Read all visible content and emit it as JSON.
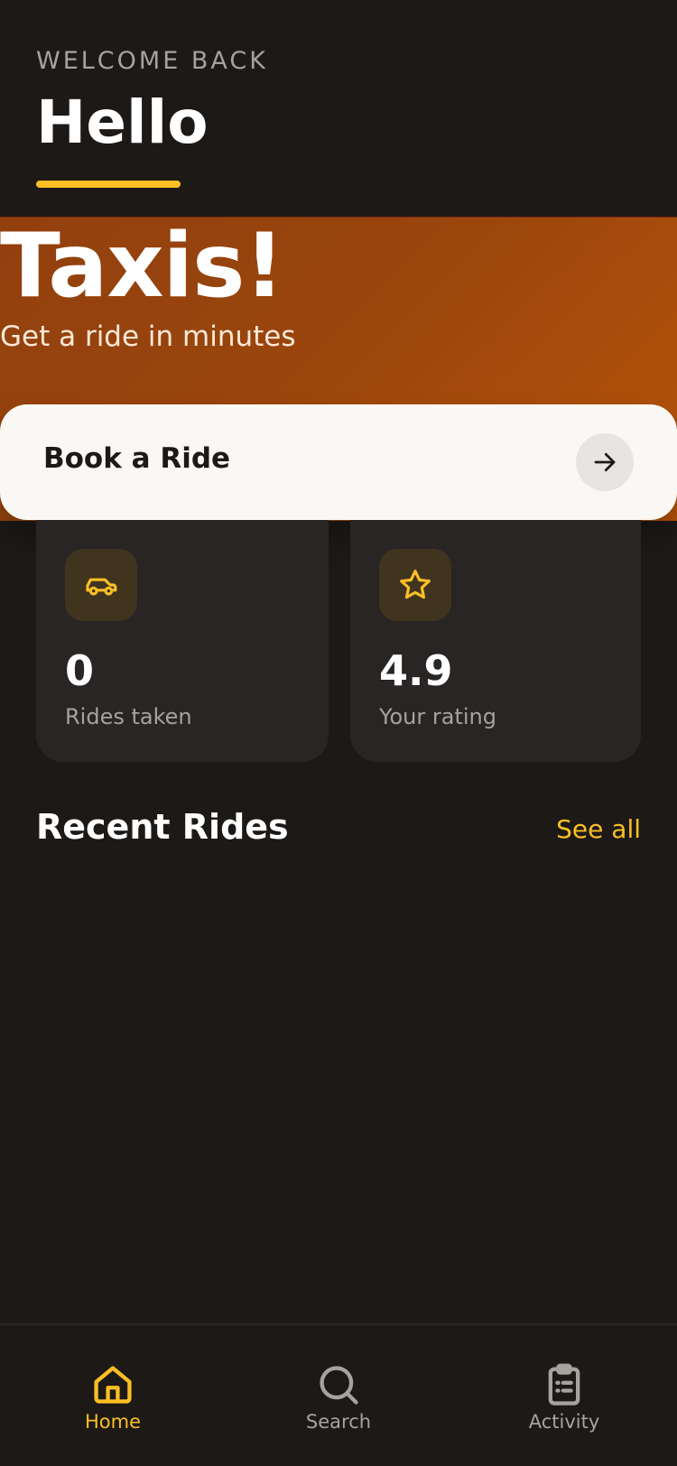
{
  "header": {
    "welcome": "WELCOME BACK",
    "greeting": "Hello"
  },
  "hero": {
    "title": "Taxis!",
    "subtitle": "Get a ride in minutes"
  },
  "book_card": {
    "label": "Book a Ride",
    "arrow_icon": "arrow-right-icon"
  },
  "stats": [
    {
      "value": "0",
      "label": "Rides taken",
      "icon": "car-icon"
    },
    {
      "value": "4.9",
      "label": "Your rating",
      "icon": "star-icon"
    }
  ],
  "recent_rides": {
    "title": "Recent Rides",
    "see_all": "See all"
  },
  "bottom_nav": {
    "items": [
      {
        "label": "Home",
        "icon": "home-icon",
        "active": true
      },
      {
        "label": "Search",
        "icon": "search-icon",
        "active": false
      },
      {
        "label": "Activity",
        "icon": "clipboard-icon",
        "active": false
      }
    ]
  },
  "colors": {
    "background": "#1c1917",
    "accent": "#fbbf24",
    "hero": "#9a450d",
    "card": "#292524",
    "book_card": "#faf8f4"
  }
}
